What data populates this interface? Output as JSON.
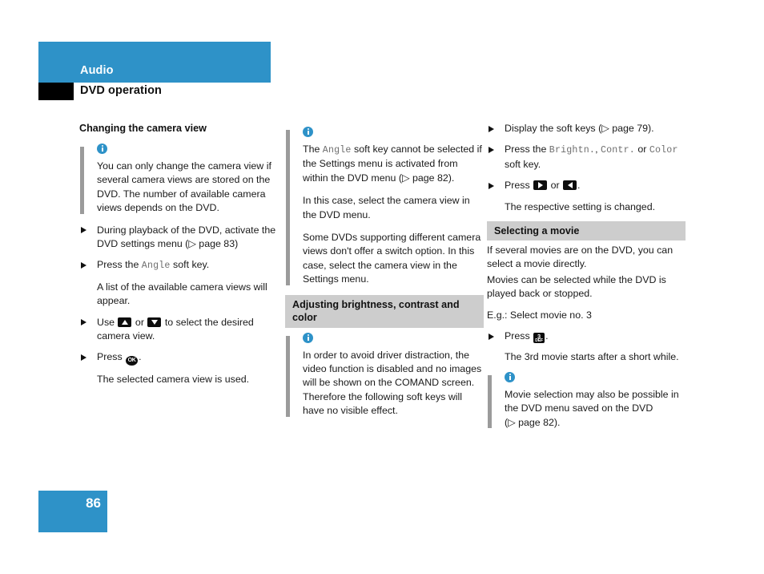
{
  "header": {
    "chapter": "Audio",
    "section": "DVD operation",
    "blue": "#2e92c8"
  },
  "footer": {
    "page_number": "86"
  },
  "columns": {
    "col1": {
      "heading": "Changing the camera view",
      "note": "You can only change the camera view if several camera views are stored on the DVD. The number of available camera views depends on the DVD.",
      "step1": "During playback of the DVD, activate the DVD settings menu (",
      "step1_page": "page 83",
      "step1_end": ")",
      "step2_pre": "Press the ",
      "step2_key": "Angle",
      "step2_post": " soft key.",
      "result1": "A list of the available camera views will appear.",
      "step3_pre": "Use ",
      "step3_mid": " or ",
      "step3_post": " to select the desired camera view.",
      "step4_pre": "Press ",
      "step4_key": "OK",
      "step4_post": ".",
      "result2": "The selected camera view is used."
    },
    "col2": {
      "note1_pre": "The ",
      "note1_key": "Angle",
      "note1_post": " soft key cannot be selected if the Settings menu is activated from within the DVD menu (",
      "note1_page": "page 82",
      "note1_end": ").",
      "note2": "In this case, select the camera view in the DVD menu.",
      "note3": "Some DVDs supporting different camera views don't offer a switch option. In this case, select the camera view in the Settings menu.",
      "band_heading": "Adjusting brightness, contrast and color",
      "note4": "In order to avoid driver distraction, the video function is disabled and no images will be shown on the COMAND screen. Therefore the following soft keys will have no visible effect."
    },
    "col3": {
      "step1_pre": "Display the soft keys (",
      "step1_page": "page 79",
      "step1_end": ").",
      "step2_pre": "Press the ",
      "step2_key1": "Brightn.",
      "step2_sep1": ", ",
      "step2_key2": "Contr.",
      "step2_sep2": " or ",
      "step2_key3": "Color",
      "step2_post": " soft key.",
      "step3_pre": "Press ",
      "step3_mid": " or ",
      "step3_post": ".",
      "result1": "The respective setting is changed.",
      "band_heading": "Selecting a movie",
      "body1": "If several movies are on the DVD, you can select a movie directly.",
      "body2": "Movies can be selected while the DVD is played back or stopped.",
      "body3": "E.g.: Select movie no. 3",
      "step4_pre": "Press ",
      "step4_key_num": "3",
      "step4_key_letters": "DEF",
      "step4_post": ".",
      "result2": "The 3rd movie starts after a short while.",
      "note_pre": "Movie selection may also be possible in the DVD menu saved on the DVD (",
      "note_page": "page 82",
      "note_end": ")."
    }
  }
}
